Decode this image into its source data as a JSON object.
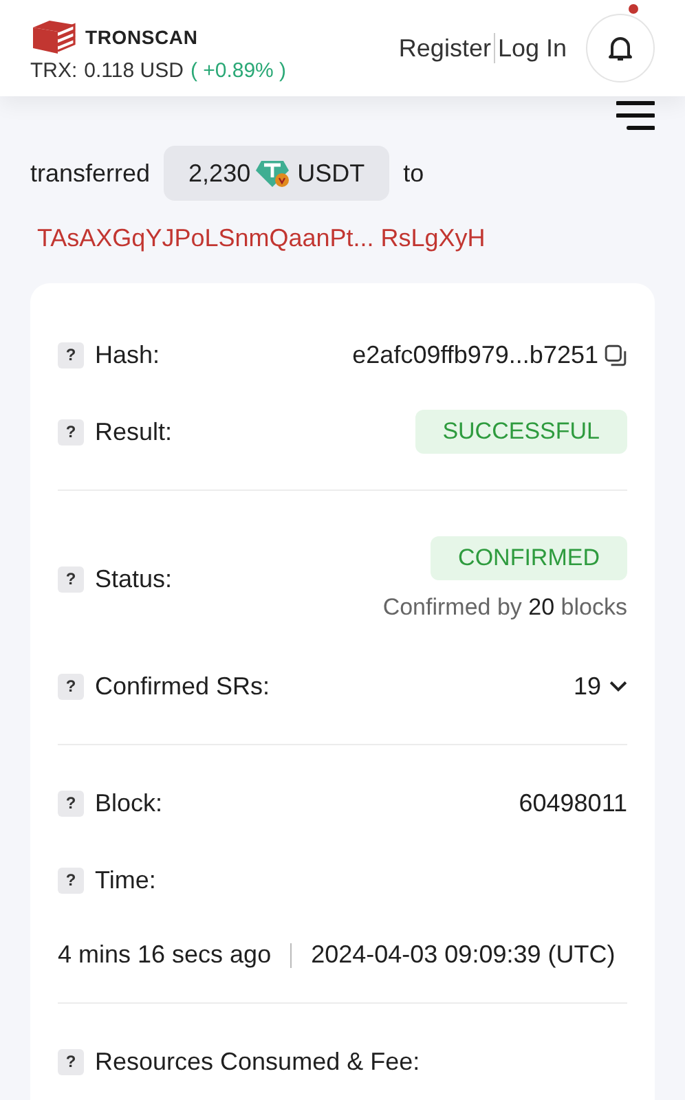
{
  "header": {
    "logo": "TRONSCAN",
    "price_label": "TRX:",
    "price": "0.118 USD",
    "change": "( +0.89% )",
    "register": "Register",
    "login": "Log In",
    "notification_dot": true
  },
  "summary": {
    "verb": "transferred",
    "amount": "2,230",
    "token": "USDT",
    "to": "to",
    "recipient": "TAsAXGqYJPoLSnmQaanPt... RsLgXyH"
  },
  "fields": [
    {
      "kind": "copy",
      "help": "?",
      "label": "Hash:",
      "value": "e2afc09ffb979...b7251"
    },
    {
      "kind": "badge",
      "help": "?",
      "label": "Result:",
      "value": "SUCCESSFUL"
    },
    {
      "kind": "divider"
    },
    {
      "kind": "status",
      "help": "?",
      "label": "Status:",
      "value": "CONFIRMED",
      "note_before": "Confirmed by",
      "note_count": "20",
      "note_after": "blocks"
    },
    {
      "kind": "dropdown",
      "help": "?",
      "label": "Confirmed SRs:",
      "value": "19"
    },
    {
      "kind": "divider"
    },
    {
      "kind": "plain",
      "help": "?",
      "label": "Block:",
      "value": "60498011"
    },
    {
      "kind": "time",
      "help": "?",
      "label": "Time:",
      "ago": "4 mins 16 secs ago",
      "timestamp": "2024-04-03 09:09:39 (UTC)"
    },
    {
      "kind": "divider"
    },
    {
      "kind": "plain",
      "help": "?",
      "label": "Resources Consumed & Fee:"
    }
  ]
}
